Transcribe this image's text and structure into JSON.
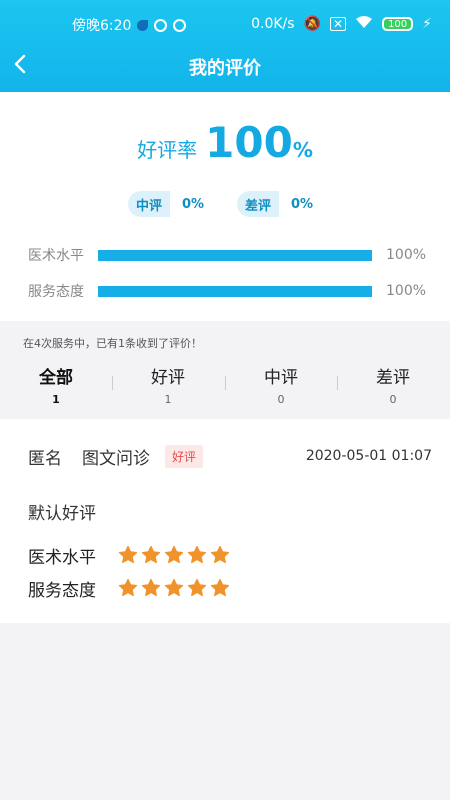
{
  "status_bar": {
    "time": "傍晚6:20",
    "network_speed": "0.0K/s",
    "battery": "100"
  },
  "nav": {
    "title": "我的评价",
    "back_icon": "chevron-left-icon"
  },
  "summary": {
    "rate_label": "好评率",
    "rate_value": "100",
    "rate_unit": "%",
    "medium": {
      "label": "中评",
      "value": "0%"
    },
    "bad": {
      "label": "差评",
      "value": "0%"
    },
    "bars": [
      {
        "label": "医术水平",
        "value": "100%",
        "fraction": 1.0
      },
      {
        "label": "服务态度",
        "value": "100%",
        "fraction": 1.0
      }
    ]
  },
  "tabs_hint": "在4次服务中，已有1条收到了评价！",
  "tabs": [
    {
      "label": "全部",
      "count": "1",
      "active": true
    },
    {
      "label": "好评",
      "count": "1",
      "active": false
    },
    {
      "label": "中评",
      "count": "0",
      "active": false
    },
    {
      "label": "差评",
      "count": "0",
      "active": false
    }
  ],
  "review": {
    "user": "匿名",
    "service_type": "图文问诊",
    "tag": "好评",
    "date": "2020-05-01 01:07",
    "content": "默认好评",
    "scores": [
      {
        "label": "医术水平",
        "stars": 5
      },
      {
        "label": "服务态度",
        "stars": 5
      }
    ]
  },
  "colors": {
    "accent": "#15a9e4",
    "star": "#f0932b",
    "tag_bg": "#fde8e8",
    "tag_text": "#e34d4d"
  }
}
